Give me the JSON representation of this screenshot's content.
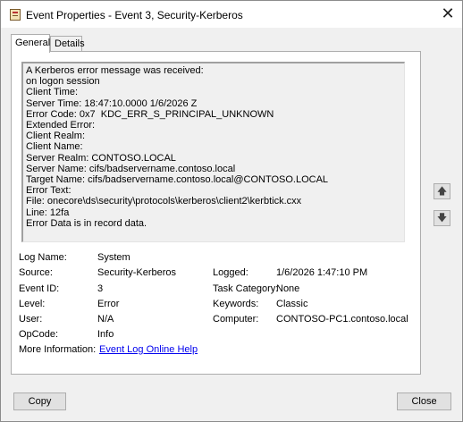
{
  "window": {
    "title": "Event Properties - Event 3, Security-Kerberos",
    "close_glyph": "✕"
  },
  "tabs": [
    {
      "label": "General",
      "active": true
    },
    {
      "label": "Details",
      "active": false
    }
  ],
  "description": "A Kerberos error message was received:\non logon session\nClient Time:\nServer Time: 18:47:10.0000 1/6/2026 Z\nError Code: 0x7  KDC_ERR_S_PRINCIPAL_UNKNOWN\nExtended Error:\nClient Realm:\nClient Name:\nServer Realm: CONTOSO.LOCAL\nServer Name: cifs/badservername.contoso.local\nTarget Name: cifs/badservername.contoso.local@CONTOSO.LOCAL\nError Text:\nFile: onecore\\ds\\security\\protocols\\kerberos\\client2\\kerbtick.cxx\nLine: 12fa\nError Data is in record data.",
  "fields": {
    "log_name": {
      "label": "Log Name:",
      "value": "System"
    },
    "source": {
      "label": "Source:",
      "value": "Security-Kerberos"
    },
    "logged": {
      "label": "Logged:",
      "value": "1/6/2026 1:47:10 PM"
    },
    "event_id": {
      "label": "Event ID:",
      "value": "3"
    },
    "task_category": {
      "label": "Task Category:",
      "value": "None"
    },
    "level": {
      "label": "Level:",
      "value": "Error"
    },
    "keywords": {
      "label": "Keywords:",
      "value": "Classic"
    },
    "user": {
      "label": "User:",
      "value": "N/A"
    },
    "computer": {
      "label": "Computer:",
      "value": "CONTOSO-PC1.contoso.local"
    },
    "opcode": {
      "label": "OpCode:",
      "value": "Info"
    },
    "more_info": {
      "label": "More Information:",
      "value": "Event Log Online Help"
    }
  },
  "side_buttons": {
    "up_icon": "up-arrow-icon",
    "down_icon": "down-arrow-icon",
    "up_glyph": "🡅",
    "down_glyph": "🡇"
  },
  "buttons": {
    "copy": "Copy",
    "close": "Close"
  },
  "colors": {
    "link": "#0000ee",
    "window_bg": "#f0f0f0"
  }
}
